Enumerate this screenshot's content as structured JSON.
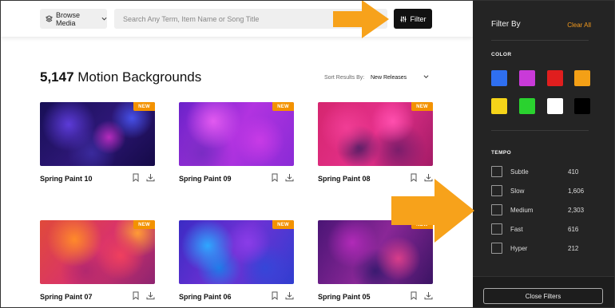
{
  "header": {
    "browse_label": "Browse Media",
    "search_placeholder": "Search Any Term, Item Name or Song Title",
    "filter_label": "Filter"
  },
  "results": {
    "count": "5,147",
    "label": " Motion Backgrounds",
    "sort_label": "Sort Results By:",
    "sort_value": "New Releases"
  },
  "cards": [
    {
      "title": "Spring Paint 10",
      "badge": "NEW"
    },
    {
      "title": "Spring Paint 09",
      "badge": "NEW"
    },
    {
      "title": "Spring Paint 08",
      "badge": "NEW"
    },
    {
      "title": "Spring Paint 07",
      "badge": "NEW"
    },
    {
      "title": "Spring Paint 06",
      "badge": "NEW"
    },
    {
      "title": "Spring Paint 05",
      "badge": "NEW"
    }
  ],
  "sidebar": {
    "title": "Filter By",
    "clear_label": "Clear All",
    "color_heading": "COLOR",
    "colors": [
      "#2f6ff0",
      "#c93ad8",
      "#e01e1e",
      "#f4a016",
      "#f5d419",
      "#2ad22f",
      "#ffffff",
      "#000000"
    ],
    "tempo_heading": "TEMPO",
    "tempo": [
      {
        "label": "Subtle",
        "count": "410"
      },
      {
        "label": "Slow",
        "count": "1,606"
      },
      {
        "label": "Medium",
        "count": "2,303"
      },
      {
        "label": "Fast",
        "count": "616"
      },
      {
        "label": "Hyper",
        "count": "212"
      }
    ],
    "close_label": "Close Filters"
  },
  "accent_color": "#f39200"
}
